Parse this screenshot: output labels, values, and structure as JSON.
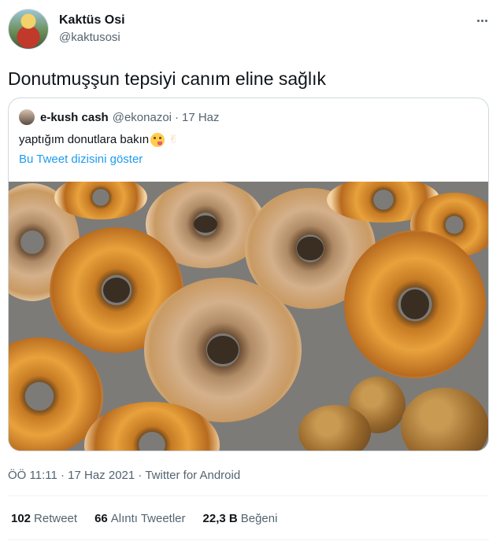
{
  "author": {
    "display_name": "Kaktüs Osi",
    "handle": "@kaktusosi",
    "avatar_icon": "avatar-photo"
  },
  "menu_icon": "more-options-icon",
  "tweet": {
    "text": "Donutmuşşun tepsiyi canım eline sağlık"
  },
  "quoted_tweet": {
    "display_name": "e-kush cash",
    "handle": "@ekonazoi",
    "separator": "·",
    "date": "17 Haz",
    "text": "yaptığım donutlara bakın",
    "emojis": [
      "face-savoring-food-emoji",
      "victory-hand-emoji"
    ],
    "thread_link": "Bu Tweet dizisini göster",
    "image": "tray of homemade glazed donuts and donut holes"
  },
  "meta": {
    "time": "ÖÖ 11:11",
    "separator": "·",
    "date": "17 Haz 2021",
    "separator2": "·",
    "source": "Twitter for Android"
  },
  "stats": {
    "retweets_count": "102",
    "retweets_label": "Retweet",
    "quotes_count": "66",
    "quotes_label": "Alıntı Tweetler",
    "likes_count": "22,3 B",
    "likes_label": "Beğeni"
  },
  "colors": {
    "link": "#1d9bf0",
    "secondary_text": "#536471",
    "primary_text": "#0f1419",
    "border": "#cfd9de"
  }
}
